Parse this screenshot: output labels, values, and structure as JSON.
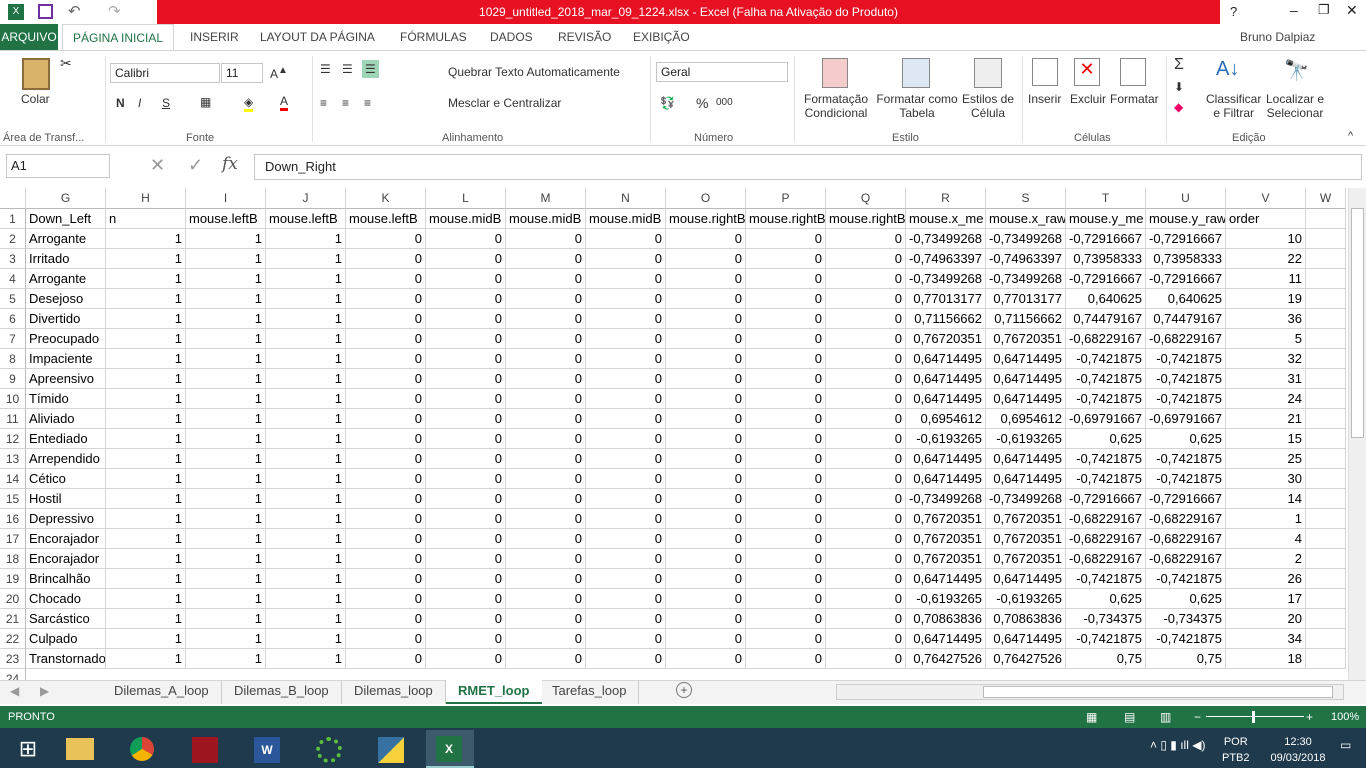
{
  "window": {
    "title": "1029_untitled_2018_mar_09_1224.xlsx -  Excel (Falha na Ativação do Produto)",
    "user": "Bruno Dalpiaz"
  },
  "tabs": [
    "ARQUIVO",
    "PÁGINA INICIAL",
    "INSERIR",
    "LAYOUT DA PÁGINA",
    "FÓRMULAS",
    "DADOS",
    "REVISÃO",
    "EXIBIÇÃO"
  ],
  "ribbon": {
    "paste": "Colar",
    "clipboard": "Área de Transf...",
    "font_name": "Calibri",
    "font_size": "11",
    "bold": "N",
    "italic": "I",
    "underline": "S",
    "font_group": "Fonte",
    "wrap": "Quebrar Texto Automaticamente",
    "merge": "Mesclar e Centralizar",
    "align_group": "Alinhamento",
    "number_format": "Geral",
    "percent": "%",
    "thousands": "000",
    "number_group": "Número",
    "cond_format": [
      "Formatação",
      "Condicional"
    ],
    "format_table": [
      "Formatar como",
      "Tabela"
    ],
    "cell_styles": [
      "Estilos de",
      "Célula"
    ],
    "styles_group": "Estilo",
    "insert": "Inserir",
    "delete": "Excluir",
    "format": "Formatar",
    "cells_group": "Células",
    "sort": [
      "Classificar",
      "e Filtrar"
    ],
    "find": [
      "Localizar e",
      "Selecionar"
    ],
    "edit_group": "Edição"
  },
  "formula_bar": {
    "name_box": "A1",
    "fx": "fx",
    "value": "Down_Right"
  },
  "columns": [
    "G",
    "H",
    "I",
    "J",
    "K",
    "L",
    "M",
    "N",
    "O",
    "P",
    "Q",
    "R",
    "S",
    "T",
    "U",
    "V",
    "W"
  ],
  "header_row": [
    "Down_Left",
    "n",
    "mouse.leftB",
    "mouse.leftB",
    "mouse.leftB",
    "mouse.midB",
    "mouse.midB",
    "mouse.midB",
    "mouse.rightB",
    "mouse.rightB",
    "mouse.rightB",
    "mouse.x_me",
    "mouse.x_raw",
    "mouse.y_me",
    "mouse.y_raw",
    "order"
  ],
  "rows": [
    [
      "Arrogante",
      "1",
      "1",
      "1",
      "0",
      "0",
      "0",
      "0",
      "0",
      "0",
      "0",
      "-0,73499268",
      "-0,73499268",
      "-0,72916667",
      "-0,72916667",
      "10"
    ],
    [
      "Irritado",
      "1",
      "1",
      "1",
      "0",
      "0",
      "0",
      "0",
      "0",
      "0",
      "0",
      "-0,74963397",
      "-0,74963397",
      "0,73958333",
      "0,73958333",
      "22"
    ],
    [
      "Arrogante",
      "1",
      "1",
      "1",
      "0",
      "0",
      "0",
      "0",
      "0",
      "0",
      "0",
      "-0,73499268",
      "-0,73499268",
      "-0,72916667",
      "-0,72916667",
      "11"
    ],
    [
      "Desejoso",
      "1",
      "1",
      "1",
      "0",
      "0",
      "0",
      "0",
      "0",
      "0",
      "0",
      "0,77013177",
      "0,77013177",
      "0,640625",
      "0,640625",
      "19"
    ],
    [
      "Divertido",
      "1",
      "1",
      "1",
      "0",
      "0",
      "0",
      "0",
      "0",
      "0",
      "0",
      "0,71156662",
      "0,71156662",
      "0,74479167",
      "0,74479167",
      "36"
    ],
    [
      "Preocupado",
      "1",
      "1",
      "1",
      "0",
      "0",
      "0",
      "0",
      "0",
      "0",
      "0",
      "0,76720351",
      "0,76720351",
      "-0,68229167",
      "-0,68229167",
      "5"
    ],
    [
      "Impaciente",
      "1",
      "1",
      "1",
      "0",
      "0",
      "0",
      "0",
      "0",
      "0",
      "0",
      "0,64714495",
      "0,64714495",
      "-0,7421875",
      "-0,7421875",
      "32"
    ],
    [
      "Apreensivo",
      "1",
      "1",
      "1",
      "0",
      "0",
      "0",
      "0",
      "0",
      "0",
      "0",
      "0,64714495",
      "0,64714495",
      "-0,7421875",
      "-0,7421875",
      "31"
    ],
    [
      "Tímido",
      "1",
      "1",
      "1",
      "0",
      "0",
      "0",
      "0",
      "0",
      "0",
      "0",
      "0,64714495",
      "0,64714495",
      "-0,7421875",
      "-0,7421875",
      "24"
    ],
    [
      "Aliviado",
      "1",
      "1",
      "1",
      "0",
      "0",
      "0",
      "0",
      "0",
      "0",
      "0",
      "0,6954612",
      "0,6954612",
      "-0,69791667",
      "-0,69791667",
      "21"
    ],
    [
      "Entediado",
      "1",
      "1",
      "1",
      "0",
      "0",
      "0",
      "0",
      "0",
      "0",
      "0",
      "-0,6193265",
      "-0,6193265",
      "0,625",
      "0,625",
      "15"
    ],
    [
      "Arrependido",
      "1",
      "1",
      "1",
      "0",
      "0",
      "0",
      "0",
      "0",
      "0",
      "0",
      "0,64714495",
      "0,64714495",
      "-0,7421875",
      "-0,7421875",
      "25"
    ],
    [
      "Cético",
      "1",
      "1",
      "1",
      "0",
      "0",
      "0",
      "0",
      "0",
      "0",
      "0",
      "0,64714495",
      "0,64714495",
      "-0,7421875",
      "-0,7421875",
      "30"
    ],
    [
      "Hostil",
      "1",
      "1",
      "1",
      "0",
      "0",
      "0",
      "0",
      "0",
      "0",
      "0",
      "-0,73499268",
      "-0,73499268",
      "-0,72916667",
      "-0,72916667",
      "14"
    ],
    [
      "Depressivo",
      "1",
      "1",
      "1",
      "0",
      "0",
      "0",
      "0",
      "0",
      "0",
      "0",
      "0,76720351",
      "0,76720351",
      "-0,68229167",
      "-0,68229167",
      "1"
    ],
    [
      "Encorajador",
      "1",
      "1",
      "1",
      "0",
      "0",
      "0",
      "0",
      "0",
      "0",
      "0",
      "0,76720351",
      "0,76720351",
      "-0,68229167",
      "-0,68229167",
      "4"
    ],
    [
      "Encorajador",
      "1",
      "1",
      "1",
      "0",
      "0",
      "0",
      "0",
      "0",
      "0",
      "0",
      "0,76720351",
      "0,76720351",
      "-0,68229167",
      "-0,68229167",
      "2"
    ],
    [
      "Brincalhão",
      "1",
      "1",
      "1",
      "0",
      "0",
      "0",
      "0",
      "0",
      "0",
      "0",
      "0,64714495",
      "0,64714495",
      "-0,7421875",
      "-0,7421875",
      "26"
    ],
    [
      "Chocado",
      "1",
      "1",
      "1",
      "0",
      "0",
      "0",
      "0",
      "0",
      "0",
      "0",
      "-0,6193265",
      "-0,6193265",
      "0,625",
      "0,625",
      "17"
    ],
    [
      "Sarcástico",
      "1",
      "1",
      "1",
      "0",
      "0",
      "0",
      "0",
      "0",
      "0",
      "0",
      "0,70863836",
      "0,70863836",
      "-0,734375",
      "-0,734375",
      "20"
    ],
    [
      "Culpado",
      "1",
      "1",
      "1",
      "0",
      "0",
      "0",
      "0",
      "0",
      "0",
      "0",
      "0,64714495",
      "0,64714495",
      "-0,7421875",
      "-0,7421875",
      "34"
    ],
    [
      "Transtornado",
      "1",
      "1",
      "1",
      "0",
      "0",
      "0",
      "0",
      "0",
      "0",
      "0",
      "0,76427526",
      "0,76427526",
      "0,75",
      "0,75",
      "18"
    ]
  ],
  "sheets": [
    "Dilemas_A_loop",
    "Dilemas_B_loop",
    "Dilemas_loop",
    "RMET_loop",
    "Tarefas_loop"
  ],
  "active_sheet": "RMET_loop",
  "status": {
    "text": "PRONTO",
    "zoom": "100%"
  },
  "taskbar": {
    "lang": [
      "POR",
      "PTB2"
    ],
    "time": "12:30",
    "date": "09/03/2018"
  },
  "colors": {
    "excel_green": "#217346",
    "title_red": "#e81123"
  }
}
